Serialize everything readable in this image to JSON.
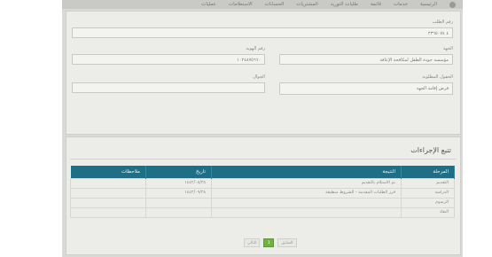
{
  "topbar": {
    "items": [
      "عمليات",
      "الاستعلامات",
      "الحسابات",
      "المشتريات",
      "طلبات التوريد",
      "قائمة",
      "خدمات",
      "الرئيسية"
    ]
  },
  "application": {
    "request_number_label": "رقم الطلب",
    "request_number_value": "٤ ٢٣٦٥٠٧٤",
    "entity_label": "الجهة",
    "entity_value": "مؤسسة جودة الطفل لمكافحة الإعاقة",
    "id_number_label": "رقم الهوية",
    "id_number_value": "١٠٢٤٨٧٥٦٦٠",
    "requested_operation_label": "الحقول المطلوبة",
    "requested_operation_value": "فرض إقامة الجهة",
    "phone_label": "الجوال",
    "phone_value": ""
  },
  "procedures": {
    "title": "تتبع الإجراءات",
    "columns": [
      "المرحلة",
      "النتيجة",
      "تاريخ",
      "ملاحظات"
    ],
    "rows": [
      [
        "التقديم",
        "تم الاستلام بالتقديم",
        "١٤٤٢/٠٨/٢٥",
        ""
      ],
      [
        "الدراسة",
        "فرز الطلبات المقدمة - الشروط منطبقة",
        "١٤٤٢/٠٩/٢٨",
        ""
      ],
      [
        "الرسوم",
        "",
        "",
        ""
      ],
      [
        "النفاذ",
        "",
        "",
        ""
      ]
    ]
  },
  "pagination": {
    "prev_label": "السابق",
    "current_page": "1",
    "next_label": "التالي"
  }
}
